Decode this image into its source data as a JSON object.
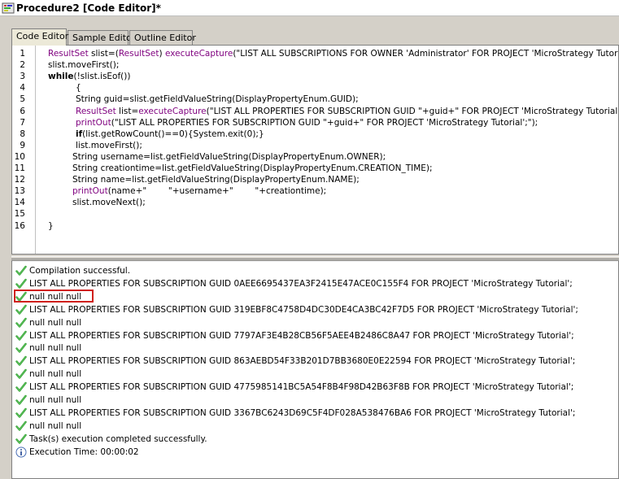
{
  "window": {
    "title": "Procedure2 [Code Editor]*"
  },
  "tabs": [
    {
      "label": "Code Editor",
      "active": true
    },
    {
      "label": "Sample Editor",
      "active": false
    },
    {
      "label": "Outline Editor",
      "active": false
    }
  ],
  "code": {
    "lines": [
      {
        "n": "1",
        "text": "ResultSet slist=(ResultSet) executeCapture(\"LIST ALL SUBSCRIPTIONS FOR OWNER 'Administrator' FOR PROJECT 'MicroStrategy Tutorial';\");"
      },
      {
        "n": "2",
        "text": "slist.moveFirst();"
      },
      {
        "n": "3",
        "text": "while(!slist.isEof())"
      },
      {
        "n": "4",
        "text": "{"
      },
      {
        "n": "5",
        "text": "String guid=slist.getFieldValueString(DisplayPropertyEnum.GUID);"
      },
      {
        "n": "6",
        "text": "ResultSet list=executeCapture(\"LIST ALL PROPERTIES FOR SUBSCRIPTION GUID \"+guid+\" FOR PROJECT 'MicroStrategy Tutorial';\");"
      },
      {
        "n": "7",
        "text": "printOut(\"LIST ALL PROPERTIES FOR SUBSCRIPTION GUID \"+guid+\" FOR PROJECT 'MicroStrategy Tutorial';\");"
      },
      {
        "n": "8",
        "text": "if(list.getRowCount()==0){System.exit(0);}"
      },
      {
        "n": "9",
        "text": "list.moveFirst();"
      },
      {
        "n": "10",
        "text": "String username=list.getFieldValueString(DisplayPropertyEnum.OWNER);"
      },
      {
        "n": "11",
        "text": "String creationtime=list.getFieldValueString(DisplayPropertyEnum.CREATION_TIME);"
      },
      {
        "n": "12",
        "text": "String name=list.getFieldValueString(DisplayPropertyEnum.NAME);"
      },
      {
        "n": "13",
        "text": "printOut(name+\"        \"+username+\"        \"+creationtime);"
      },
      {
        "n": "14",
        "text": "slist.moveNext();"
      },
      {
        "n": "15",
        "text": ""
      },
      {
        "n": "16",
        "text": "}"
      }
    ]
  },
  "output": {
    "rows": [
      {
        "icon": "check-icon",
        "text": "Compilation successful."
      },
      {
        "icon": "check-icon",
        "text": "LIST ALL PROPERTIES FOR SUBSCRIPTION GUID 0AEE6695437EA3F2415E47ACE0C155F4 FOR PROJECT 'MicroStrategy Tutorial';"
      },
      {
        "icon": "check-icon",
        "text": "null null null"
      },
      {
        "icon": "check-icon",
        "text": "LIST ALL PROPERTIES FOR SUBSCRIPTION GUID 319EBF8C4758D4DC30DE4CA3BC42F7D5 FOR PROJECT 'MicroStrategy Tutorial';"
      },
      {
        "icon": "check-icon",
        "text": "null null null"
      },
      {
        "icon": "check-icon",
        "text": "LIST ALL PROPERTIES FOR SUBSCRIPTION GUID 7797AF3E4B28CB56F5AEE4B2486C8A47 FOR PROJECT 'MicroStrategy Tutorial';"
      },
      {
        "icon": "check-icon",
        "text": "null null null"
      },
      {
        "icon": "check-icon",
        "text": "LIST ALL PROPERTIES FOR SUBSCRIPTION GUID 863AEBD54F33B201D7BB3680E0E22594 FOR PROJECT 'MicroStrategy Tutorial';"
      },
      {
        "icon": "check-icon",
        "text": "null null null"
      },
      {
        "icon": "check-icon",
        "text": "LIST ALL PROPERTIES FOR SUBSCRIPTION GUID 4775985141BC5A54F8B4F98D42B63F8B FOR PROJECT 'MicroStrategy Tutorial';"
      },
      {
        "icon": "check-icon",
        "text": "null null null"
      },
      {
        "icon": "check-icon",
        "text": "LIST ALL PROPERTIES FOR SUBSCRIPTION GUID 3367BC6243D69C5F4DF028A538476BA6 FOR PROJECT 'MicroStrategy Tutorial';"
      },
      {
        "icon": "check-icon",
        "text": "null null null"
      },
      {
        "icon": "check-icon",
        "text": "Task(s) execution completed successfully."
      },
      {
        "icon": "info-icon",
        "text": "Execution Time: 00:00:02"
      }
    ],
    "highlighted_row": "null null null"
  },
  "colors": {
    "keyword": "#000000",
    "type": "#7f007f",
    "check": "#2e9d2e",
    "highlight_border": "#d0201c"
  }
}
